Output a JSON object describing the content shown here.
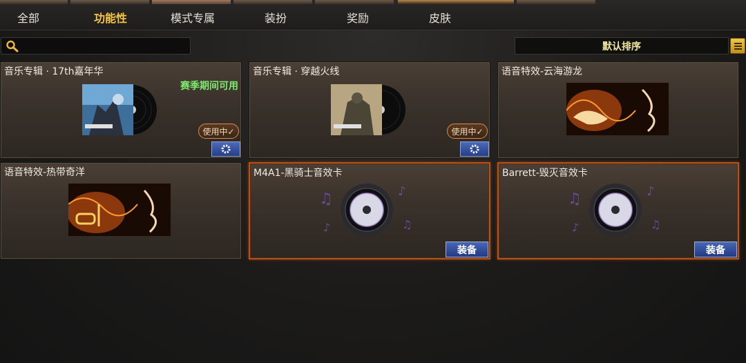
{
  "tabs": [
    {
      "label": "全部"
    },
    {
      "label": "功能性"
    },
    {
      "label": "模式专属"
    },
    {
      "label": "装扮"
    },
    {
      "label": "奖励"
    },
    {
      "label": "皮肤"
    }
  ],
  "search": {
    "value": "",
    "icon": "search-icon"
  },
  "sort": {
    "label": "默认排序",
    "icon": "menu-icon"
  },
  "colors": {
    "accent": "#f5c542",
    "season": "#7dea6e",
    "equip_border": "#b6531d"
  },
  "items": [
    {
      "title": "音乐专辑 · 17th嘉年华",
      "season": "赛季期间可用",
      "status": "使用中✓",
      "action_icon": "gear-icon"
    },
    {
      "title": "音乐专辑 · 穿越火线",
      "status": "使用中✓",
      "action_icon": "gear-icon"
    },
    {
      "title": "语音特效-云海游龙"
    },
    {
      "title": "语音特效-热带奇洋"
    },
    {
      "title": "M4A1-黑骑士音效卡",
      "action": "装备"
    },
    {
      "title": "Barrett-毁灭音效卡",
      "action": "装备"
    }
  ]
}
